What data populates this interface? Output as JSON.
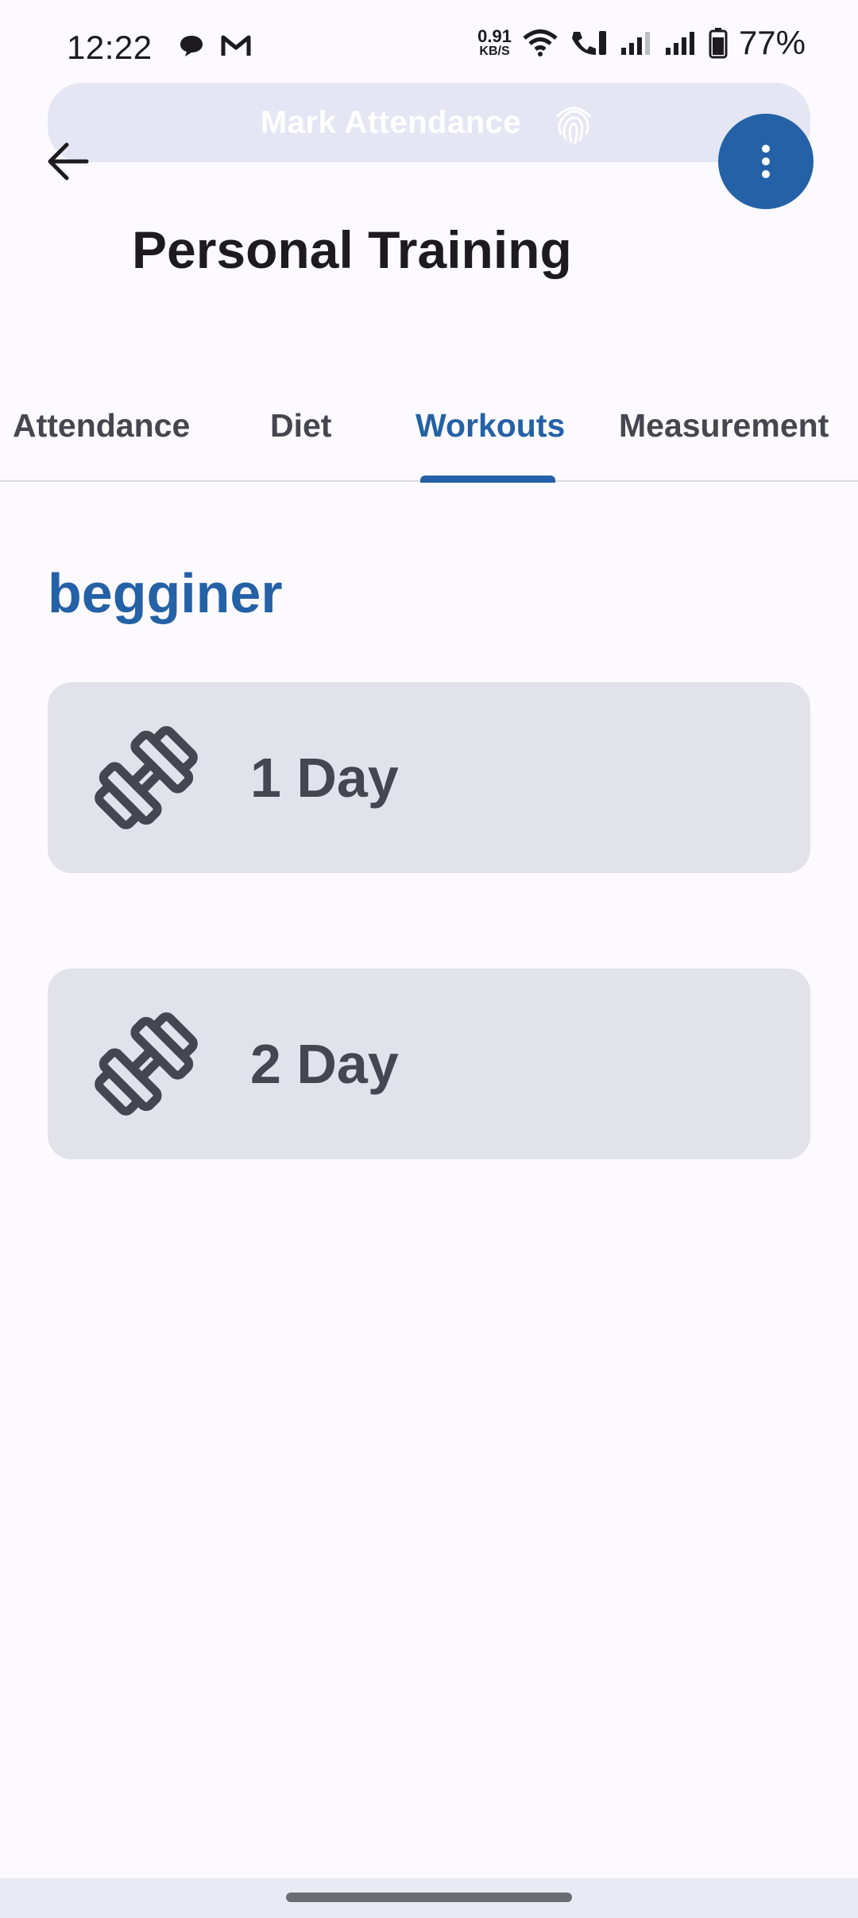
{
  "status_bar": {
    "time": "12:22",
    "net_speed_value": "0.91",
    "net_speed_unit": "KB/S",
    "battery": "77%",
    "icons": [
      "chat-bubble-icon",
      "gmail-icon",
      "wifi-icon",
      "wifi-call-icon",
      "signal-icon",
      "signal-icon",
      "battery-icon"
    ]
  },
  "mark_attendance": {
    "label": "Mark Attendance",
    "icon": "fingerprint-icon"
  },
  "header": {
    "back_icon": "arrow-left-icon",
    "menu_icon": "more-vert-icon",
    "title": "Personal Training"
  },
  "tabs": [
    {
      "label": "Attendance",
      "active": false
    },
    {
      "label": "Diet",
      "active": false
    },
    {
      "label": "Workouts",
      "active": true
    },
    {
      "label": "Measurement",
      "active": false
    }
  ],
  "section": {
    "title": "begginer"
  },
  "workouts": [
    {
      "label": "1 Day",
      "icon": "dumbbell-icon"
    },
    {
      "label": "2 Day",
      "icon": "dumbbell-icon"
    }
  ],
  "colors": {
    "accent": "#2461a6",
    "card_bg": "#e1e2ea",
    "background": "#fcfafe",
    "pill_bg": "#e4e6f4"
  }
}
